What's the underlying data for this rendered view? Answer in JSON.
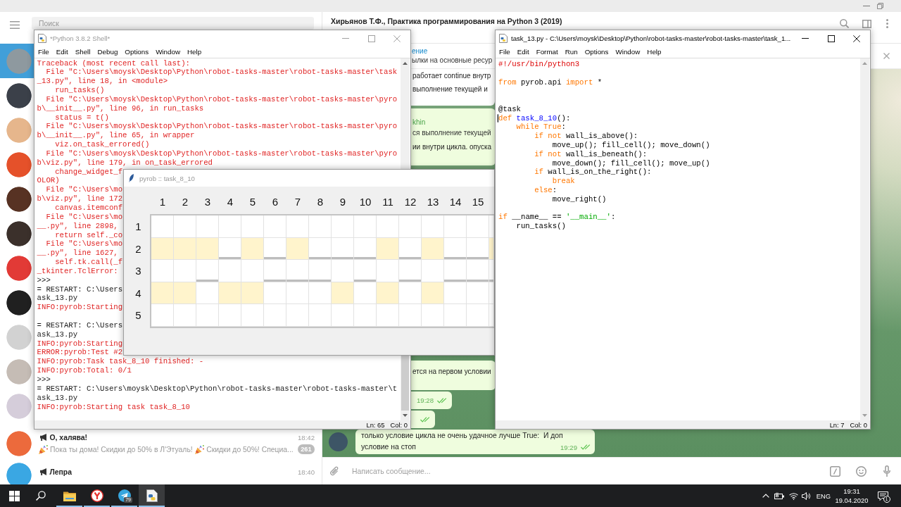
{
  "telegram": {
    "sidebar": {
      "search": {
        "placeholder": "Поиск"
      },
      "chats": [
        {
          "selected": true,
          "color": "#8e999f"
        },
        {
          "selected": false,
          "color": "#3b4049"
        },
        {
          "selected": false,
          "color": "#e6b68c"
        },
        {
          "selected": false,
          "color": "#e5512a"
        },
        {
          "selected": false,
          "color": "#573223"
        },
        {
          "selected": false,
          "color": "#3b302b"
        },
        {
          "selected": false,
          "color": "#e23a36"
        },
        {
          "selected": false,
          "color": "#202020"
        },
        {
          "selected": false,
          "color": "#d2d2d2"
        },
        {
          "selected": false,
          "color": "#c5bcb5"
        },
        {
          "selected": false,
          "color": "#d5cdda"
        },
        {
          "selected": false,
          "color": "#ec6a3c",
          "channel": true,
          "name": "О, халява!",
          "time": "18:42",
          "preview": [
            "Пока ты дома! Скидки до 50% в Л'Этуаль!",
            "Скидки до 50%! Специа..."
          ],
          "badge": "261"
        },
        {
          "selected": false,
          "color": "#3aa7e3",
          "channel": true,
          "name": "Лепра",
          "time": "18:40"
        }
      ]
    },
    "chat": {
      "title": "Хирьянов Т.Ф., Практика программирования на Python 3 (2019)",
      "pinned": {
        "title": "ение",
        "text": "ылки на основные ресур"
      },
      "messages": [
        {
          "kind": "incoming",
          "avatar": false,
          "lines": [
            "работает continue внутр",
            "выполнение текущей и"
          ]
        },
        {
          "kind": "outgoing",
          "avatar": false,
          "reply": {
            "author": "khin",
            "text": "ся выполнение текущей"
          },
          "lines": [
            "ии внутри цикла. опуска"
          ]
        },
        {
          "kind": "outgoing",
          "avatar": false,
          "lines": [
            "ется на первом условии"
          ]
        },
        {
          "kind": "outgoing",
          "avatar": false,
          "time": "19:28",
          "read": true
        },
        {
          "kind": "outgoing",
          "avatar": false,
          "read": true
        },
        {
          "kind": "outgoing",
          "avatar": true,
          "lines": [
            "только условие цикла не очень удачное лучше True:  И доп",
            "условие на стоп"
          ],
          "time": "19:29",
          "read": true
        }
      ],
      "composer": {
        "placeholder": "Написать сообщение..."
      }
    }
  },
  "shell_window": {
    "title": "*Python 3.8.2 Shell*",
    "active": false,
    "menu": [
      "File",
      "Edit",
      "Shell",
      "Debug",
      "Options",
      "Window",
      "Help"
    ],
    "lines": [
      {
        "kind": "stderr",
        "text": "Traceback (most recent call last):"
      },
      {
        "kind": "stderr",
        "text": "  File \"C:\\Users\\moysk\\Desktop\\Python\\robot-tasks-master\\robot-tasks-master\\task"
      },
      {
        "kind": "stderr",
        "text": "_13.py\", line 18, in <module>"
      },
      {
        "kind": "stderr",
        "text": "    run_tasks()"
      },
      {
        "kind": "stderr",
        "text": "  File \"C:\\Users\\moysk\\Desktop\\Python\\robot-tasks-master\\robot-tasks-master\\pyro"
      },
      {
        "kind": "stderr",
        "text": "b\\__init__.py\", line 96, in run_tasks"
      },
      {
        "kind": "stderr",
        "text": "    status = t()"
      },
      {
        "kind": "stderr",
        "text": "  File \"C:\\Users\\moysk\\Desktop\\Python\\robot-tasks-master\\robot-tasks-master\\pyro"
      },
      {
        "kind": "stderr",
        "text": "b\\__init__.py\", line 65, in wrapper"
      },
      {
        "kind": "stderr",
        "text": "    viz.on_task_errored()"
      },
      {
        "kind": "stderr",
        "text": "  File \"C:\\Users\\moysk\\Desktop\\Python\\robot-tasks-master\\robot-tasks-master\\pyro"
      },
      {
        "kind": "stderr",
        "text": "b\\viz.py\", line 179, in on_task_errored"
      },
      {
        "kind": "stderr",
        "text": "    change_widget_f"
      },
      {
        "kind": "stderr",
        "text": "OLOR)"
      },
      {
        "kind": "stderr",
        "text": "  File \"C:\\Users\\mo"
      },
      {
        "kind": "stderr",
        "text": "b\\viz.py\", line 172"
      },
      {
        "kind": "stderr",
        "text": "    canvas.itemconf"
      },
      {
        "kind": "stderr",
        "text": "  File \"C:\\Users\\mo"
      },
      {
        "kind": "stderr",
        "text": "__.py\", line 2898,"
      },
      {
        "kind": "stderr",
        "text": "    return self._co"
      },
      {
        "kind": "stderr",
        "text": "  File \"C:\\Users\\mo"
      },
      {
        "kind": "stderr",
        "text": "__.py\", line 1627,"
      },
      {
        "kind": "stderr",
        "text": "    self.tk.call(_f"
      },
      {
        "kind": "stderr",
        "text": "_tkinter.TclError:"
      },
      {
        "kind": "console",
        "text": ">>>"
      },
      {
        "kind": "console",
        "text": "= RESTART: C:\\Users"
      },
      {
        "kind": "console",
        "text": "ask_13.py"
      },
      {
        "kind": "stderr",
        "text": "INFO:pyrob:Starting"
      },
      {
        "kind": "blank"
      },
      {
        "kind": "console",
        "text": "= RESTART: C:\\Users"
      },
      {
        "kind": "console",
        "text": "ask_13.py"
      },
      {
        "kind": "stderr",
        "text": "INFO:pyrob:Starting"
      },
      {
        "kind": "stderr",
        "text": "ERROR:pyrob:Test #2"
      },
      {
        "kind": "stderr",
        "text": "INFO:pyrob:Task task_8_10 finished: -"
      },
      {
        "kind": "stderr",
        "text": "INFO:pyrob:Total: 0/1"
      },
      {
        "kind": "console",
        "text": ">>>"
      },
      {
        "kind": "console",
        "text": "= RESTART: C:\\Users\\moysk\\Desktop\\Python\\robot-tasks-master\\robot-tasks-master\\t"
      },
      {
        "kind": "console",
        "text": "ask_13.py"
      },
      {
        "kind": "stderr",
        "text": "INFO:pyrob:Starting task task_8_10"
      }
    ],
    "status": {
      "line": "Ln: 65",
      "column": "Col: 0"
    }
  },
  "grid_window": {
    "title": "pyrob :: task_8_10",
    "active": false,
    "column_labels": [
      "1",
      "2",
      "3",
      "4",
      "5",
      "6",
      "7",
      "8",
      "9",
      "10",
      "11",
      "12",
      "13",
      "14",
      "15"
    ],
    "row_labels": [
      "1",
      "2",
      "3",
      "4",
      "5"
    ],
    "rows": [
      {
        "filled": [
          false,
          false,
          false,
          false,
          false,
          false,
          false,
          false,
          false,
          false,
          false,
          false,
          false,
          false,
          false,
          false
        ],
        "wall_below": [
          false,
          false,
          false,
          false,
          false,
          false,
          false,
          false,
          false,
          false,
          false,
          false,
          false,
          false,
          false,
          false
        ]
      },
      {
        "filled": [
          true,
          true,
          true,
          false,
          true,
          false,
          true,
          false,
          false,
          false,
          true,
          false,
          true,
          false,
          false,
          true
        ],
        "wall_below": [
          false,
          false,
          false,
          true,
          false,
          true,
          false,
          true,
          true,
          true,
          false,
          true,
          false,
          true,
          true,
          false
        ]
      },
      {
        "filled": [
          false,
          false,
          false,
          false,
          false,
          false,
          false,
          false,
          false,
          false,
          false,
          false,
          false,
          false,
          false,
          false
        ],
        "wall_below": [
          false,
          false,
          true,
          false,
          false,
          true,
          true,
          true,
          false,
          true,
          false,
          true,
          false,
          true,
          true,
          true
        ]
      },
      {
        "filled": [
          true,
          true,
          false,
          true,
          true,
          false,
          false,
          false,
          true,
          false,
          true,
          false,
          true,
          false,
          false,
          false
        ],
        "wall_below": [
          false,
          false,
          false,
          false,
          false,
          false,
          false,
          false,
          false,
          false,
          false,
          false,
          false,
          false,
          false,
          false
        ]
      },
      {
        "filled": [
          false,
          false,
          false,
          false,
          false,
          false,
          false,
          false,
          false,
          false,
          false,
          false,
          false,
          false,
          false,
          false
        ],
        "wall_below": [
          false,
          false,
          false,
          false,
          false,
          false,
          false,
          false,
          false,
          false,
          false,
          false,
          false,
          false,
          false,
          false
        ]
      }
    ]
  },
  "editor_window": {
    "title": "task_13.py - C:\\Users\\moysk\\Desktop\\Python\\robot-tasks-master\\robot-tasks-master\\task_1...",
    "active": true,
    "menu": [
      "File",
      "Edit",
      "Format",
      "Run",
      "Options",
      "Window",
      "Help"
    ],
    "lines": [
      {
        "kind": "code",
        "cursor": false,
        "tokens": [
          {
            "text": "#!/usr/bin/python3",
            "kind": "comment"
          }
        ]
      },
      {
        "kind": "blank"
      },
      {
        "kind": "code",
        "cursor": false,
        "tokens": [
          {
            "text": "from",
            "kind": "keyword"
          },
          {
            "text": " pyrob.api ",
            "kind": "plain"
          },
          {
            "text": "import",
            "kind": "keyword"
          },
          {
            "text": " *",
            "kind": "plain"
          }
        ]
      },
      {
        "kind": "blank"
      },
      {
        "kind": "blank"
      },
      {
        "kind": "code",
        "cursor": false,
        "tokens": [
          {
            "text": "@task",
            "kind": "plain"
          }
        ]
      },
      {
        "kind": "code",
        "cursor": true,
        "tokens": [
          {
            "text": "def",
            "kind": "keyword"
          },
          {
            "text": " task_8_10",
            "kind": "definition"
          },
          {
            "text": "():",
            "kind": "plain"
          }
        ]
      },
      {
        "kind": "code",
        "cursor": false,
        "tokens": [
          {
            "text": "    while True",
            "kind": "keyword"
          },
          {
            "text": ":",
            "kind": "plain"
          }
        ]
      },
      {
        "kind": "code",
        "cursor": false,
        "tokens": [
          {
            "text": "        if not",
            "kind": "keyword"
          },
          {
            "text": " wall_is_above():",
            "kind": "plain"
          }
        ]
      },
      {
        "kind": "code",
        "cursor": false,
        "tokens": [
          {
            "text": "            move_up(); fill_cell(); move_down()",
            "kind": "plain"
          }
        ]
      },
      {
        "kind": "code",
        "cursor": false,
        "tokens": [
          {
            "text": "        if not",
            "kind": "keyword"
          },
          {
            "text": " wall_is_beneath():",
            "kind": "plain"
          }
        ]
      },
      {
        "kind": "code",
        "cursor": false,
        "tokens": [
          {
            "text": "            move_down(); fill_cell(); move_up()",
            "kind": "plain"
          }
        ]
      },
      {
        "kind": "code",
        "cursor": false,
        "tokens": [
          {
            "text": "        if",
            "kind": "keyword"
          },
          {
            "text": " wall_is_on_the_right():",
            "kind": "plain"
          }
        ]
      },
      {
        "kind": "code",
        "cursor": false,
        "tokens": [
          {
            "text": "            break",
            "kind": "keyword"
          }
        ]
      },
      {
        "kind": "code",
        "cursor": false,
        "tokens": [
          {
            "text": "        else",
            "kind": "keyword"
          },
          {
            "text": ":",
            "kind": "plain"
          }
        ]
      },
      {
        "kind": "code",
        "cursor": false,
        "tokens": [
          {
            "text": "            move_right()",
            "kind": "plain"
          }
        ]
      },
      {
        "kind": "blank"
      },
      {
        "kind": "code",
        "cursor": false,
        "tokens": [
          {
            "text": "if",
            "kind": "keyword"
          },
          {
            "text": " __name__ == ",
            "kind": "plain"
          },
          {
            "text": "'__main__'",
            "kind": "string"
          },
          {
            "text": ":",
            "kind": "plain"
          }
        ]
      },
      {
        "kind": "code",
        "cursor": false,
        "tokens": [
          {
            "text": "    run_tasks()",
            "kind": "plain"
          }
        ]
      }
    ],
    "status": {
      "line": "Ln: 7",
      "column": "Col: 0"
    }
  },
  "taskbar": {
    "apps": [
      {
        "kind": "folder",
        "running": true,
        "active": false
      },
      {
        "kind": "browser",
        "running": true,
        "active": false
      },
      {
        "kind": "messenger",
        "running": true,
        "active": false,
        "badge": "79"
      },
      {
        "kind": "python",
        "running": true,
        "active": true
      }
    ],
    "language": "ENG",
    "time": "19:31",
    "date": "19.04.2020",
    "notifications": "1"
  }
}
